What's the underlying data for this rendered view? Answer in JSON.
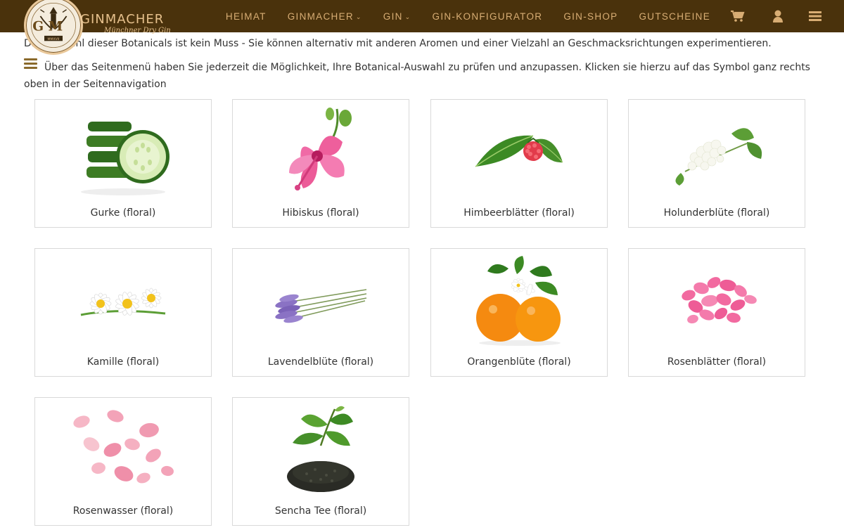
{
  "brand": {
    "name": "GINMACHER",
    "subtitle": "Münchner Dry Gin",
    "logo_text": "G M",
    "seal_text": "MMXVII"
  },
  "nav": {
    "items": [
      {
        "label": "HEIMAT",
        "dropdown": false
      },
      {
        "label": "GINMACHER",
        "dropdown": true
      },
      {
        "label": "GIN",
        "dropdown": true
      },
      {
        "label": "GIN-KONFIGURATOR",
        "dropdown": false
      },
      {
        "label": "GIN-SHOP",
        "dropdown": false
      },
      {
        "label": "GUTSCHEINE",
        "dropdown": false
      }
    ],
    "icons": [
      "cart-icon",
      "user-icon",
      "hamburger-menu-icon"
    ]
  },
  "intro": {
    "line1": "Die Auswahl dieser Botanicals ist kein Muss - Sie können alternativ mit anderen Aromen und einer Vielzahl an Geschmacksrichtungen experimentieren.",
    "line2": "Über das Seitenmenü haben Sie jederzeit die Möglichkeit, Ihre Botanical-Auswahl zu prüfen und anzupassen. Klicken sie hierzu auf das Symbol ganz rechts oben in der Seitennavigation"
  },
  "botanicals": [
    {
      "label": "Gurke (floral)",
      "image": "cucumber-image"
    },
    {
      "label": "Hibiskus (floral)",
      "image": "hibiscus-image"
    },
    {
      "label": "Himbeerblätter (floral)",
      "image": "raspberry-leaf-image"
    },
    {
      "label": "Holunderblüte (floral)",
      "image": "elderflower-image"
    },
    {
      "label": "Kamille (floral)",
      "image": "chamomile-image"
    },
    {
      "label": "Lavendelblüte (floral)",
      "image": "lavender-image"
    },
    {
      "label": "Orangenblüte (floral)",
      "image": "orange-blossom-image"
    },
    {
      "label": "Rosenblätter (floral)",
      "image": "rose-petals-image"
    },
    {
      "label": "Rosenwasser (floral)",
      "image": "rosewater-petals-image"
    },
    {
      "label": "Sencha Tee (floral)",
      "image": "sencha-tea-image"
    }
  ],
  "colors": {
    "navbar": "#4a320c",
    "nav_text": "#d8ad74",
    "brand_text": "#e6c08c",
    "tile_border": "#d9d9d9",
    "body_text": "#333333"
  }
}
